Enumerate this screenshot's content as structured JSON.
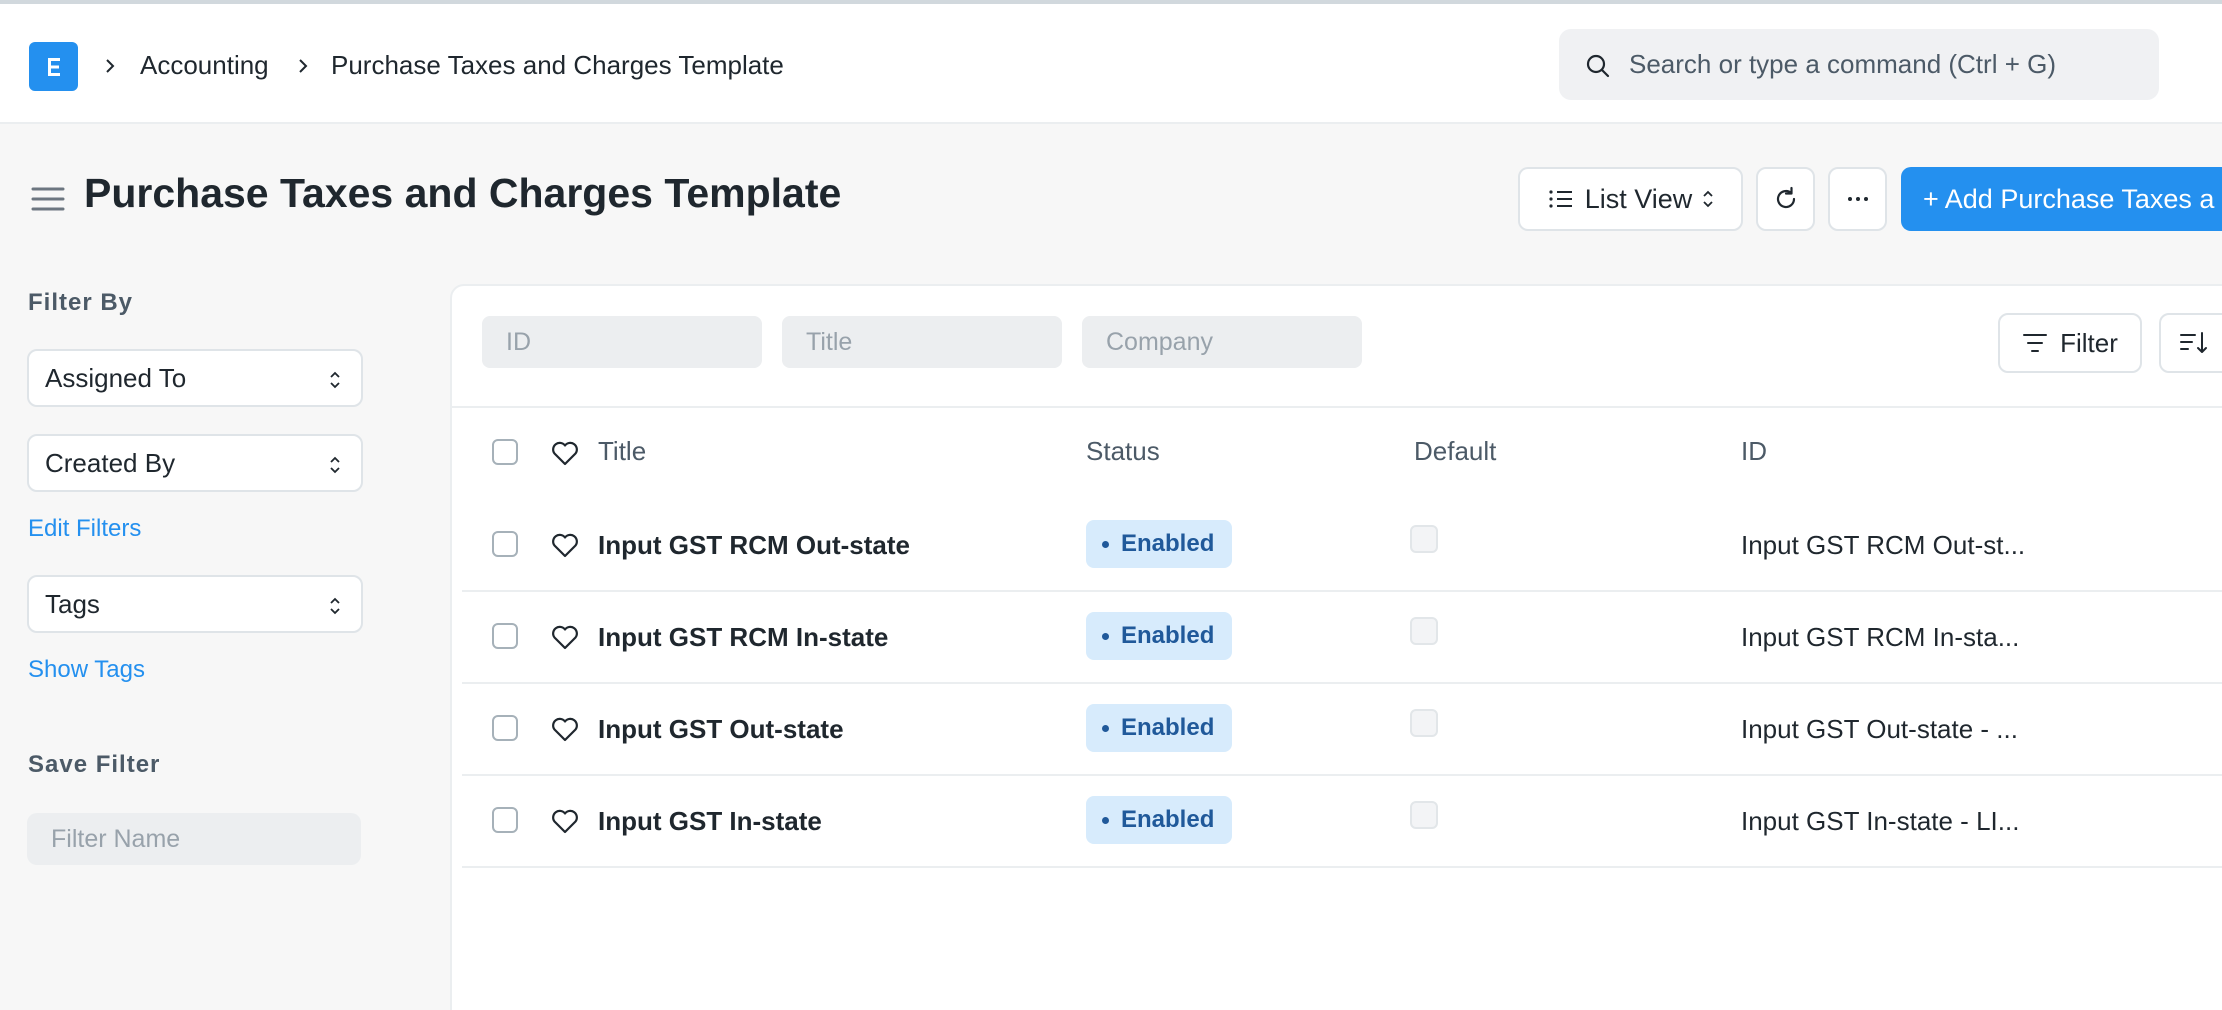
{
  "navbar": {
    "breadcrumbs": [
      "Accounting",
      "Purchase Taxes and Charges Template"
    ],
    "search_placeholder": "Search or type a command (Ctrl + G)"
  },
  "page": {
    "title": "Purchase Taxes and Charges Template",
    "list_view_label": "List View",
    "add_button_label": "+ Add Purchase Taxes a"
  },
  "sidebar": {
    "filter_by_label": "Filter By",
    "assigned_to": "Assigned To",
    "created_by": "Created By",
    "edit_filters": "Edit Filters",
    "tags": "Tags",
    "show_tags": "Show Tags",
    "save_filter_label": "Save Filter",
    "filter_name_placeholder": "Filter Name"
  },
  "filters": {
    "id_placeholder": "ID",
    "title_placeholder": "Title",
    "company_placeholder": "Company",
    "filter_button": "Filter"
  },
  "table": {
    "columns": {
      "title": "Title",
      "status": "Status",
      "default": "Default",
      "id": "ID"
    },
    "rows": [
      {
        "title": "Input GST RCM Out-state",
        "status": "Enabled",
        "id": "Input GST RCM Out-st..."
      },
      {
        "title": "Input GST RCM In-state",
        "status": "Enabled",
        "id": "Input GST RCM In-sta..."
      },
      {
        "title": "Input GST Out-state",
        "status": "Enabled",
        "id": "Input GST Out-state - ..."
      },
      {
        "title": "Input GST In-state",
        "status": "Enabled",
        "id": "Input GST In-state - LI..."
      }
    ]
  },
  "colors": {
    "primary": "#2490ef",
    "status_bg": "#d7ebfc",
    "status_text": "#20599a"
  }
}
